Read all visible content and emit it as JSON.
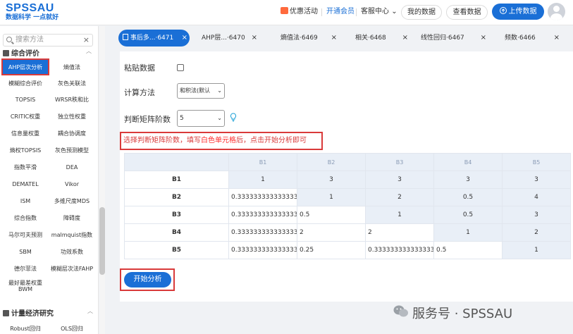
{
  "logo": {
    "main": "SPSSAU",
    "sub": "数据科学 一点就好"
  },
  "header": {
    "promo": "优惠活动",
    "member": "开通会员",
    "service": "客服中心",
    "service_chevron": "⌄",
    "my_data": "我的数据",
    "view_data": "查看数据",
    "upload": "上传数据"
  },
  "sidebar": {
    "search_placeholder": "搜索方法",
    "search_clear": "×",
    "category1": "综合评价",
    "category2": "计量经济研究",
    "chevron_up": "︿",
    "items": [
      "AHP层次分析",
      "熵值法",
      "模糊综合评价",
      "灰色关联法",
      "TOPSIS",
      "WRSR秩和比",
      "CRITIC权重",
      "独立性权重",
      "信息量权重",
      "耦合协调度",
      "熵权TOPSIS",
      "灰色预测模型",
      "指数平滑",
      "DEA",
      "DEMATEL",
      "Vikor",
      "ISM",
      "多维尺度MDS",
      "综合指数",
      "障碍度",
      "马尔可夫预测",
      "malmquist指数",
      "SBM",
      "功效系数",
      "德尔菲法",
      "模糊层次法FAHP",
      "最好最差权重BWM",
      ""
    ],
    "items2": [
      "Robust回归",
      "OLS回归"
    ]
  },
  "tabs": [
    {
      "label": "事后多...·6471",
      "close": "×"
    },
    {
      "label": "AHP层...·6470",
      "close": "×"
    },
    {
      "label": "熵值法·6469",
      "close": "×"
    },
    {
      "label": "相关·6468",
      "close": "×"
    },
    {
      "label": "线性回归·6467",
      "close": "×"
    },
    {
      "label": "频数·6466",
      "close": "×"
    }
  ],
  "form": {
    "paste_label": "粘贴数据",
    "method_label": "计算方法",
    "method_value": "和积法(默认",
    "order_label": "判断矩阵阶数",
    "order_value": "5",
    "caret": "⌄"
  },
  "hint": {
    "part1": "选择判断矩阵阶数，填写",
    "highlight": "白色单元格",
    "part2": "后，点击开始分析即可"
  },
  "matrix": {
    "col_headers": [
      "B1",
      "B2",
      "B3",
      "B4",
      "B5"
    ],
    "rows": [
      {
        "label": "B1",
        "cells": [
          "1",
          "3",
          "3",
          "3",
          "3"
        ]
      },
      {
        "label": "B2",
        "cells": [
          "0.3333333333333333",
          "1",
          "2",
          "0.5",
          "4"
        ]
      },
      {
        "label": "B3",
        "cells": [
          "0.3333333333333333",
          "0.5",
          "1",
          "0.5",
          "3"
        ]
      },
      {
        "label": "B4",
        "cells": [
          "0.3333333333333333",
          "2",
          "2",
          "1",
          "2"
        ]
      },
      {
        "label": "B5",
        "cells": [
          "0.3333333333333333",
          "0.25",
          "0.3333333333333333",
          "0.5",
          "1"
        ]
      }
    ]
  },
  "start_button": "开始分析",
  "watermark": "服务号 · SPSSAU"
}
